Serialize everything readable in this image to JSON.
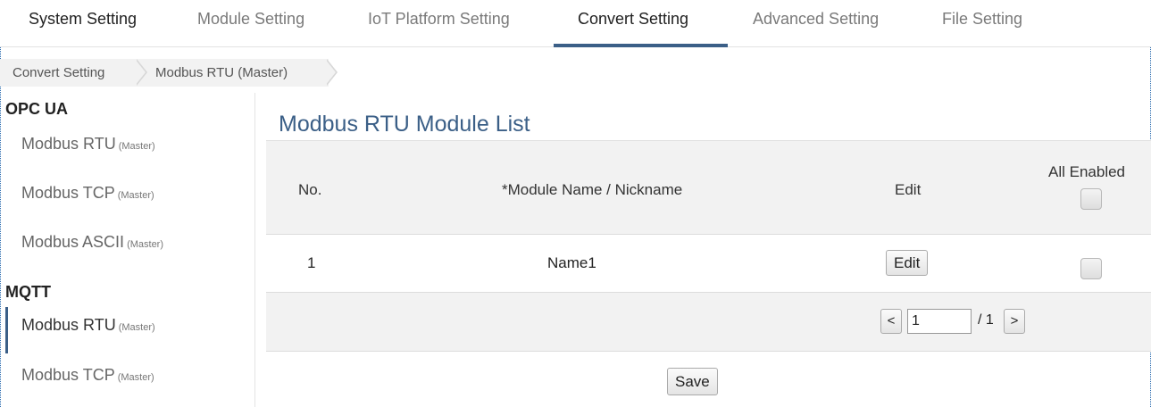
{
  "nav": {
    "tabs": [
      {
        "label": "System Setting"
      },
      {
        "label": "Module Setting"
      },
      {
        "label": "IoT Platform Setting"
      },
      {
        "label": "Convert Setting"
      },
      {
        "label": "Advanced Setting"
      },
      {
        "label": "File Setting"
      }
    ],
    "active_tab": "Convert Setting"
  },
  "breadcrumb": [
    "Convert Setting",
    "Modbus RTU (Master)"
  ],
  "sidebar": {
    "groups": [
      {
        "heading": "OPC UA"
      },
      {
        "heading": "MQTT"
      }
    ],
    "items": [
      {
        "label": "Modbus RTU",
        "sub": "(Master)"
      },
      {
        "label": "Modbus TCP",
        "sub": "(Master)"
      },
      {
        "label": "Modbus ASCII",
        "sub": "(Master)"
      },
      {
        "label": "Modbus RTU",
        "sub": "(Master)"
      },
      {
        "label": "Modbus TCP",
        "sub": "(Master)"
      }
    ],
    "active_item": "MQTT / Modbus RTU (Master)"
  },
  "main": {
    "title": "Modbus RTU Module List",
    "table": {
      "headers": {
        "no": "No.",
        "name": "*Module Name / Nickname",
        "edit": "Edit",
        "all_enabled": "All Enabled"
      },
      "rows": [
        {
          "no": "1",
          "name": "Name1",
          "edit_label": "Edit"
        }
      ]
    },
    "pager": {
      "prev": "<",
      "next": ">",
      "page": "1",
      "total": "/ 1"
    },
    "save_label": "Save"
  },
  "colors": {
    "accent": "#3b5f87",
    "header_bg": "#f2f2f2"
  }
}
